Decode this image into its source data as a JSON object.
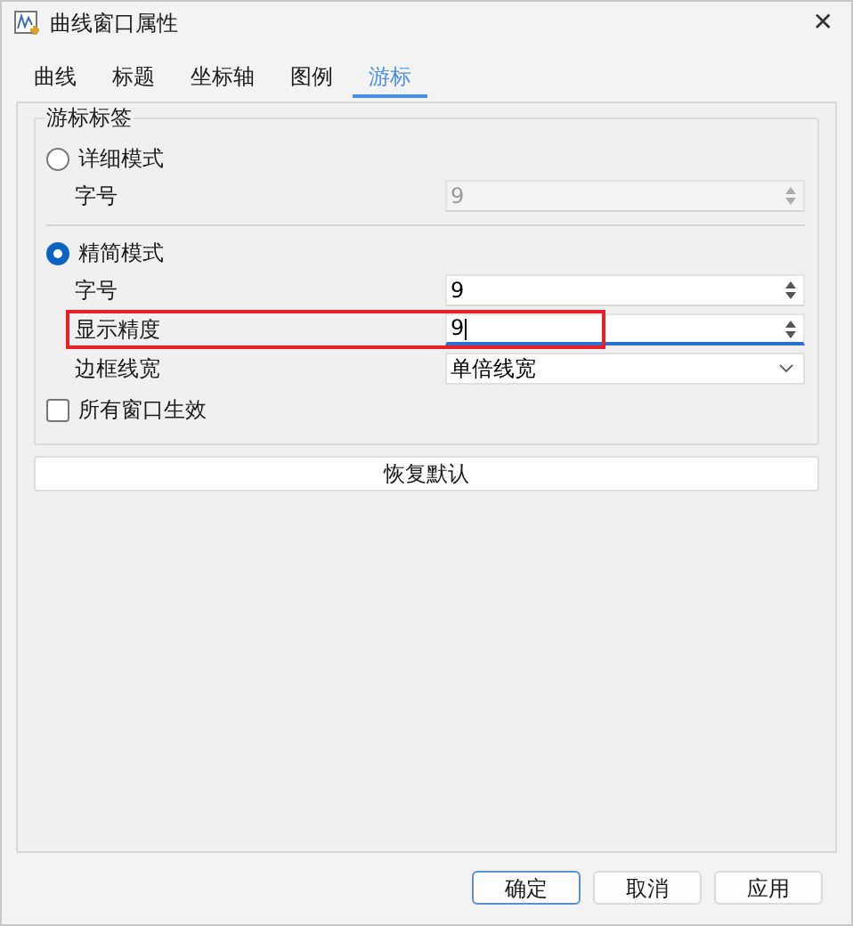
{
  "window": {
    "title": "曲线窗口属性",
    "close": "✕"
  },
  "tabs": [
    {
      "label": "曲线",
      "selected": false
    },
    {
      "label": "标题",
      "selected": false
    },
    {
      "label": "坐标轴",
      "selected": false
    },
    {
      "label": "图例",
      "selected": false
    },
    {
      "label": "游标",
      "selected": true
    }
  ],
  "group": {
    "title": "游标标签",
    "modes": [
      {
        "label": "详细模式",
        "selected": false,
        "fields": [
          {
            "kind": "spin",
            "label": "字号",
            "value": "9",
            "disabled": true,
            "focused": false,
            "highlighted": false
          }
        ]
      },
      {
        "label": "精简模式",
        "selected": true,
        "fields": [
          {
            "kind": "spin",
            "label": "字号",
            "value": "9",
            "disabled": false,
            "focused": false,
            "highlighted": false
          },
          {
            "kind": "spin",
            "label": "显示精度",
            "value": "9",
            "disabled": false,
            "focused": true,
            "highlighted": true
          },
          {
            "kind": "select",
            "label": "边框线宽",
            "value": "单倍线宽",
            "disabled": false,
            "focused": false,
            "highlighted": false
          }
        ]
      }
    ],
    "apply_all": {
      "label": "所有窗口生效",
      "checked": false
    }
  },
  "restore_button": "恢复默认",
  "buttons": [
    {
      "label": "确定",
      "default": true
    },
    {
      "label": "取消",
      "default": false
    },
    {
      "label": "应用",
      "default": false
    }
  ]
}
